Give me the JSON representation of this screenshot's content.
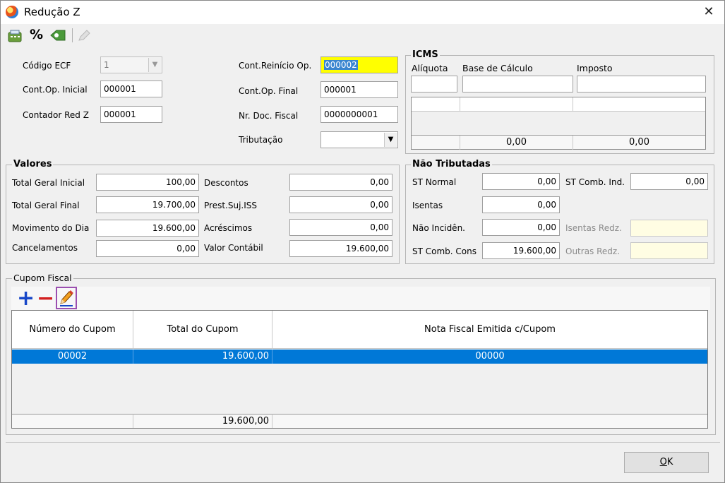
{
  "window": {
    "title": "Redução Z",
    "close_symbol": "✕"
  },
  "toolbar": {
    "icons": [
      "calculator-icon",
      "percent-icon",
      "tag-icon",
      "pencil-disabled-icon"
    ],
    "percent_label": "%"
  },
  "top": {
    "codigo_ecf_label": "Código ECF",
    "codigo_ecf_value": "1",
    "cont_op_inicial_label": "Cont.Op. Inicial",
    "cont_op_inicial_value": "000001",
    "contador_red_z_label": "Contador Red Z",
    "contador_red_z_value": "000001",
    "cont_reinicio_label": "Cont.Reinício Op.",
    "cont_reinicio_value": "000002",
    "cont_op_final_label": "Cont.Op. Final",
    "cont_op_final_value": "000001",
    "nr_doc_fiscal_label": "Nr. Doc. Fiscal",
    "nr_doc_fiscal_value": "0000000001",
    "tributacao_label": "Tributação",
    "tributacao_value": ""
  },
  "icms": {
    "title": "ICMS",
    "col_aliquota": "Alíquota",
    "col_base": "Base de Cálculo",
    "col_imposto": "Imposto",
    "total_base": "0,00",
    "total_imposto": "0,00"
  },
  "valores": {
    "title": "Valores",
    "total_geral_inicial_label": "Total Geral Inicial",
    "total_geral_inicial_value": "100,00",
    "total_geral_final_label": "Total Geral Final",
    "total_geral_final_value": "19.700,00",
    "movimento_dia_label": "Movimento do Dia",
    "movimento_dia_value": "19.600,00",
    "cancelamentos_label": "Cancelamentos",
    "cancelamentos_value": "0,00",
    "descontos_label": "Descontos",
    "descontos_value": "0,00",
    "prest_iss_label": "Prest.Suj.ISS",
    "prest_iss_value": "0,00",
    "acrescimos_label": "Acréscimos",
    "acrescimos_value": "0,00",
    "valor_contabil_label": "Valor Contábil",
    "valor_contabil_value": "19.600,00"
  },
  "nao_tributadas": {
    "title": "Não Tributadas",
    "st_normal_label": "ST Normal",
    "st_normal_value": "0,00",
    "isentas_label": "Isentas",
    "isentas_value": "0,00",
    "nao_incid_label": "Não Incidên.",
    "nao_incid_value": "0,00",
    "st_comb_cons_label": "ST Comb. Cons",
    "st_comb_cons_value": "19.600,00",
    "st_comb_ind_label": "ST Comb. Ind.",
    "st_comb_ind_value": "0,00",
    "isentas_redz_label": "Isentas Redz.",
    "isentas_redz_value": "",
    "outras_redz_label": "Outras Redz.",
    "outras_redz_value": ""
  },
  "cupom": {
    "title": "Cupom Fiscal",
    "add_label": "+",
    "remove_label": "−",
    "columns": [
      "Número do Cupom",
      "Total do Cupom",
      "Nota Fiscal Emitida c/Cupom"
    ],
    "rows": [
      {
        "numero": "00002",
        "total": "19.600,00",
        "nota": "00000"
      }
    ],
    "footer_total": "19.600,00"
  },
  "buttons": {
    "ok_underlined": "O",
    "ok_rest": "K"
  }
}
